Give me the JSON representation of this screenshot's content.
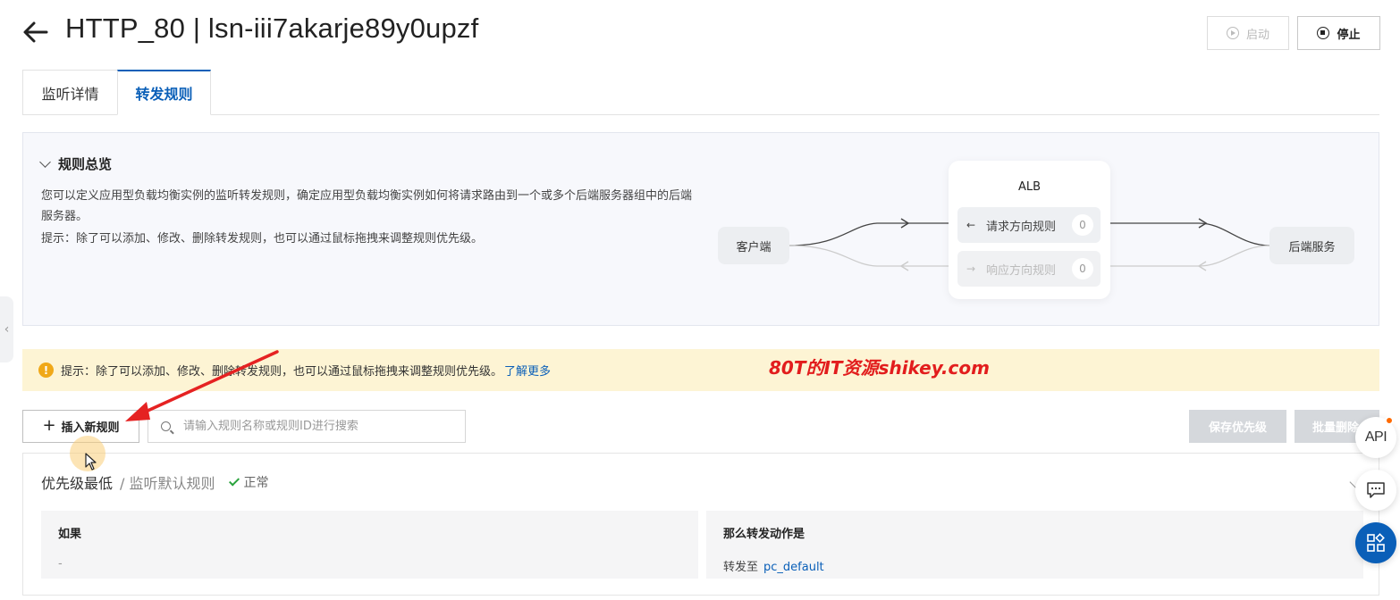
{
  "header": {
    "title": "HTTP_80 | lsn-iii7akarje89y0upzf",
    "start_label": "启动",
    "stop_label": "停止"
  },
  "tabs": [
    {
      "label": "监听详情",
      "active": false
    },
    {
      "label": "转发规则",
      "active": true
    }
  ],
  "overview": {
    "title": "规则总览",
    "description": "您可以定义应用型负载均衡实例的监听转发规则，确定应用型负载均衡实例如何将请求路由到一个或多个后端服务器组中的后端服务器。",
    "tip": "提示：除了可以添加、修改、删除转发规则，也可以通过鼠标拖拽来调整规则优先级。",
    "diagram": {
      "client": "客户端",
      "alb": "ALB",
      "request_rule": "请求方向规则",
      "request_count": "0",
      "response_rule": "响应方向规则",
      "response_count": "0",
      "backend": "后端服务"
    }
  },
  "alert": {
    "icon": "!",
    "text": "提示：除了可以添加、修改、删除转发规则，也可以通过鼠标拖拽来调整规则优先级。",
    "link": "了解更多"
  },
  "watermark": "80T的IT资源shikey.com",
  "toolbar": {
    "add_label": "插入新规则",
    "search_placeholder": "请输入规则名称或规则ID进行搜索",
    "save_priority_label": "保存优先级",
    "bulk_delete_label": "批量删除"
  },
  "rule": {
    "priority": "优先级最低",
    "name": "/ 监听默认规则",
    "status": "正常",
    "if_header": "如果",
    "if_value": "-",
    "then_header": "那么转发动作是",
    "then_prefix": "转发至",
    "then_target": "pc_default"
  },
  "floating": {
    "api_label": "API"
  },
  "colors": {
    "primary": "#0a5fb8",
    "alert_bg": "#fdf4d4",
    "warn": "#f0a818",
    "success": "#2aa33d",
    "watermark": "#e21d1d"
  }
}
